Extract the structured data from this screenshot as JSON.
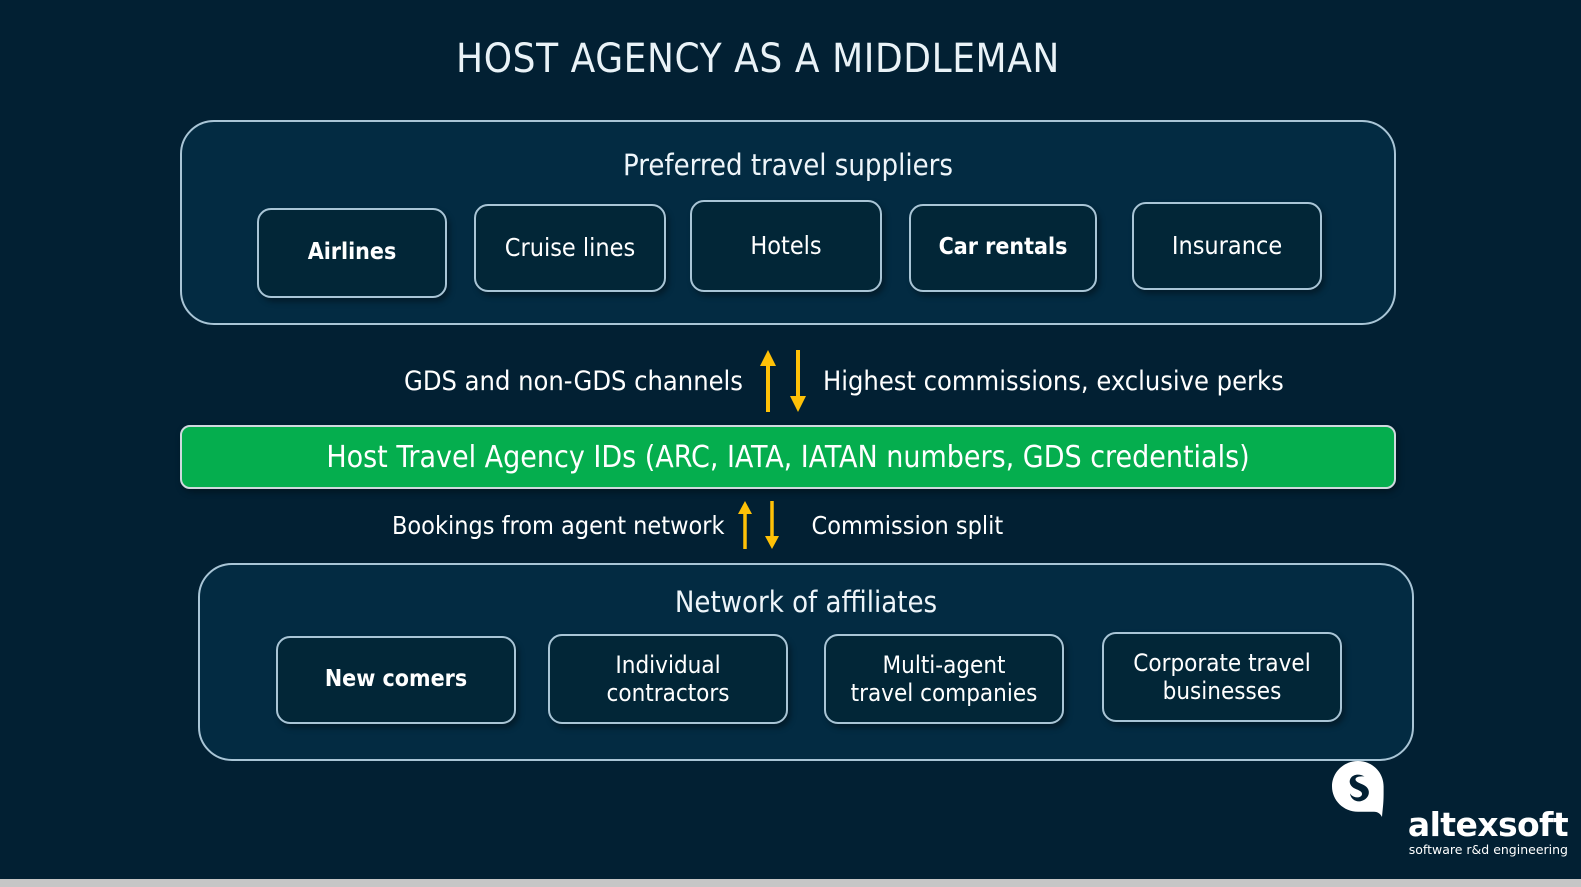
{
  "title": "HOST AGENCY AS A MIDDLEMAN",
  "colors": {
    "background": "#022033",
    "panel_fill": "#032b42",
    "panel_border": "#a9c5d6",
    "box_fill": "#022637",
    "accent_green": "#05ae4e",
    "arrow_amber": "#ffc107",
    "text": "#ffffff",
    "bottom_strip": "#c6c6c6"
  },
  "suppliers_panel": {
    "heading": "Preferred travel suppliers",
    "items": [
      {
        "label": "Airlines"
      },
      {
        "label": "Cruise lines"
      },
      {
        "label": "Hotels"
      },
      {
        "label": "Car rentals"
      },
      {
        "label": "Insurance"
      }
    ]
  },
  "upper_flow": {
    "left_label": "GDS and non-GDS channels",
    "up_arrow_icon": "arrow-up-icon",
    "down_arrow_icon": "arrow-down-icon",
    "right_label": "Highest commissions, exclusive perks"
  },
  "center_bar": {
    "label": "Host Travel Agency IDs (ARC, IATA, IATAN numbers, GDS credentials)"
  },
  "lower_flow": {
    "left_label": "Bookings from agent network",
    "up_arrow_icon": "arrow-up-icon",
    "down_arrow_icon": "arrow-down-icon",
    "right_label": "Commission split"
  },
  "affiliates_panel": {
    "heading": "Network of affiliates",
    "items": [
      {
        "line1": "New comers",
        "line2": ""
      },
      {
        "line1": "Individual",
        "line2": "contractors"
      },
      {
        "line1": "Multi-agent",
        "line2": "travel companies"
      },
      {
        "line1": "Corporate travel",
        "line2": "businesses"
      }
    ]
  },
  "logo": {
    "mark_icon": "altexsoft-bubble-icon",
    "wordmark": "altexsoft",
    "tagline": "software r&d engineering"
  }
}
